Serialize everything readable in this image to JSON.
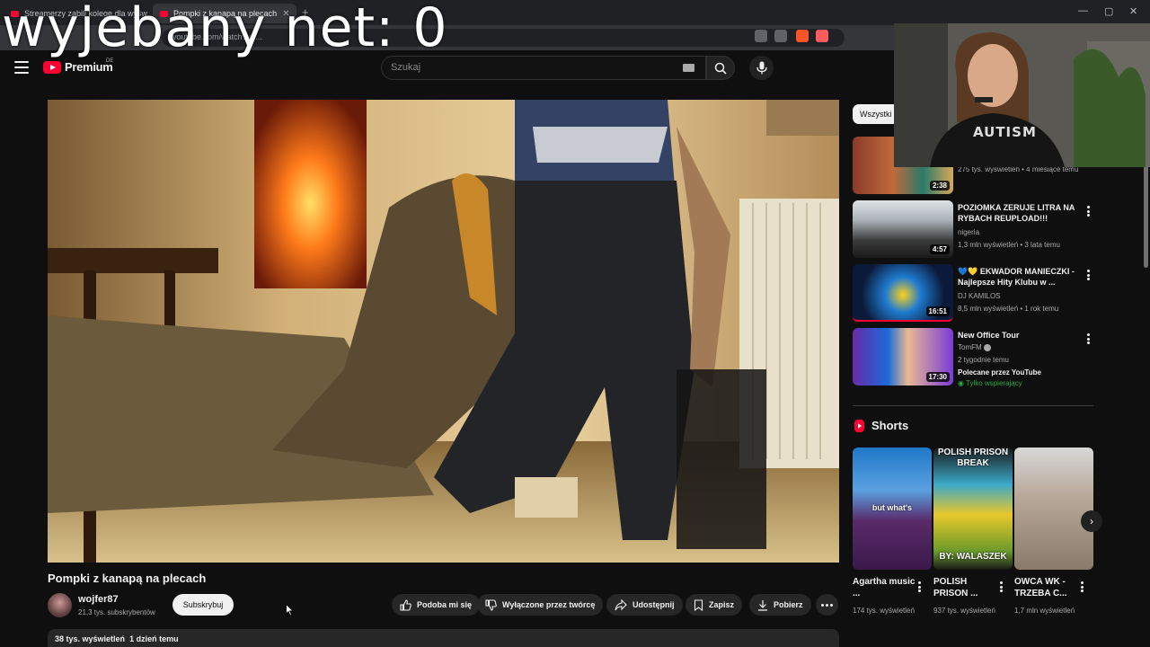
{
  "browser": {
    "tabs": [
      {
        "label": "Streamerzy zabili kolegę dla wyświetleń",
        "active": false
      },
      {
        "label": "Pompki z kanapą na plecach",
        "active": true
      }
    ],
    "new_tab": "+",
    "address": "youtube.com/watch?v=...",
    "window_controls": {
      "minimize": "—",
      "maximize": "▢",
      "close": "✕"
    }
  },
  "overlay": {
    "counter_text": "wyjebany net: 0"
  },
  "webcam": {
    "shirt_text": "AUTISM"
  },
  "header": {
    "logo_text": "Premium",
    "country": "DE",
    "search_placeholder": "Szukaj"
  },
  "video": {
    "title": "Pompki z kanapą na plecach",
    "channel": "wojfer87",
    "subscribers": "21,3 tys. subskrybentów",
    "subscribe_label": "Subskrybuj",
    "actions": {
      "like": "Podoba mi się",
      "dislike": "Wyłączone przez twórcę",
      "share": "Udostępnij",
      "save": "Zapisz",
      "download": "Pobierz"
    },
    "views": "38 tys. wyświetleń",
    "age": "1 dzień temu"
  },
  "sidebar": {
    "chip_label": "Wszystki",
    "recommendations": [
      {
        "title": "",
        "channel": "",
        "meta": "275 tys. wyświetleń • 4 miesiące temu",
        "duration": "2:38"
      },
      {
        "title": "POZIOMKA ZERUJE LITRA NA RYBACH REUPLOAD!!!",
        "channel": "nigeria",
        "meta": "1,3 mln wyświetleń • 3 lata temu",
        "duration": "4:57"
      },
      {
        "title": "💙💛 EKWADOR MANIECZKI - Najlepsze Hity Klubu w ...",
        "channel": "DJ KAMILOS",
        "meta": "8,5 mln wyświetleń • 1 rok temu",
        "duration": "16:51"
      },
      {
        "title": "New Office Tour",
        "channel": "TomFM",
        "meta": "2 tygodnie temu",
        "extra": "Polecane przez YouTube",
        "badge": "Tylko wspierający",
        "duration": "17:30"
      }
    ],
    "shorts_heading": "Shorts",
    "shorts": [
      {
        "title": "Agartha music ...",
        "views": "174 tys. wyświetleń",
        "caption": "but what's"
      },
      {
        "title": "POLISH PRISON ...",
        "views": "937 tys. wyświetleń",
        "caption": "POLISH PRISON BREAK",
        "caption2": "BY: WALASZEK"
      },
      {
        "title": "OWCA WK - TRZEBA C...",
        "views": "1,7 mln wyświetleń",
        "caption": ""
      }
    ],
    "next_label": "›"
  }
}
